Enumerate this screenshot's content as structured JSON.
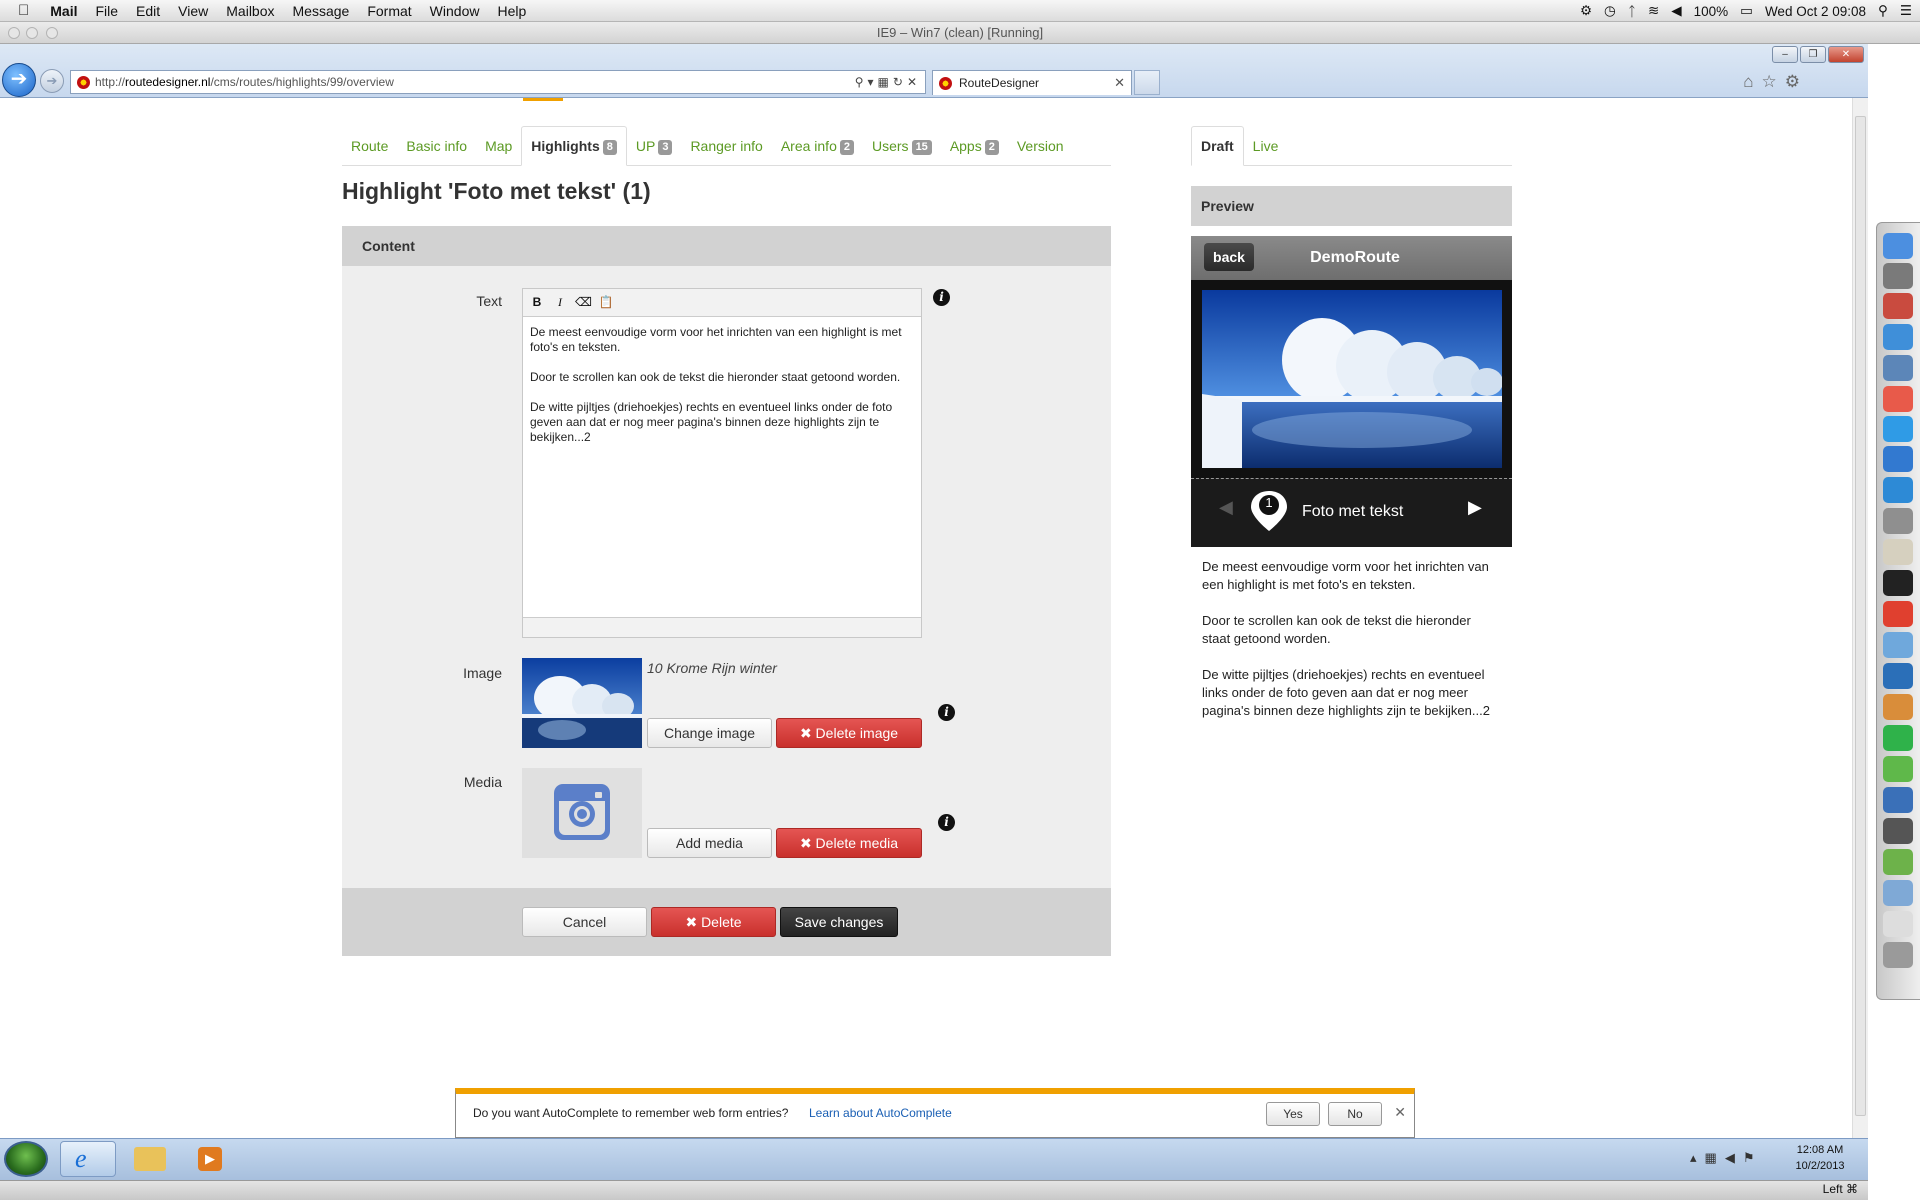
{
  "menubar": {
    "app": "Mail",
    "items": [
      "File",
      "Edit",
      "View",
      "Mailbox",
      "Message",
      "Format",
      "Window",
      "Help"
    ],
    "battery": "100%",
    "datetime": "Wed Oct 2  09:08"
  },
  "vm_title": "IE9 – Win7 (clean) [Running]",
  "browser": {
    "url_prefix": "http://",
    "url_domain": "routedesigner.nl",
    "url_path": "/cms/routes/highlights/99/overview",
    "tab_title": "RouteDesigner"
  },
  "tabs": [
    {
      "label": "Route",
      "badge": ""
    },
    {
      "label": "Basic info",
      "badge": ""
    },
    {
      "label": "Map",
      "badge": ""
    },
    {
      "label": "Highlights",
      "badge": "8",
      "active": true
    },
    {
      "label": "UP",
      "badge": "3"
    },
    {
      "label": "Ranger info",
      "badge": ""
    },
    {
      "label": "Area info",
      "badge": "2"
    },
    {
      "label": "Users",
      "badge": "15"
    },
    {
      "label": "Apps",
      "badge": "2"
    },
    {
      "label": "Version",
      "badge": ""
    }
  ],
  "page_title": "Highlight 'Foto met tekst' (1)",
  "content": {
    "section_title": "Content",
    "text_label": "Text",
    "editor_tools": [
      "B",
      "I",
      "eraser",
      "paste"
    ],
    "paragraphs": [
      "De meest eenvoudige vorm voor het inrichten van een highlight is met foto's en teksten.",
      "Door te scrollen kan ook de tekst die hieronder staat getoond worden.",
      "De witte pijltjes (driehoekjes) rechts en eventueel links onder de foto geven aan dat er nog meer pagina's binnen deze highlights zijn te bekijken...2"
    ],
    "image_label": "Image",
    "image_name": "10 Krome Rijn winter",
    "change_image": "Change image",
    "delete_image": "✖ Delete image",
    "media_label": "Media",
    "add_media": "Add media",
    "delete_media": "✖ Delete media",
    "cancel": "Cancel",
    "delete": "✖ Delete",
    "save": "Save changes"
  },
  "preview": {
    "tabs": [
      "Draft",
      "Live"
    ],
    "title": "Preview",
    "back": "back",
    "app_title": "DemoRoute",
    "marker_number": "1",
    "highlight_title": "Foto met tekst"
  },
  "notification": {
    "message": "Do you want AutoComplete to remember web form entries?",
    "link": "Learn about AutoComplete",
    "yes": "Yes",
    "no": "No"
  },
  "taskbar": {
    "time": "12:08 AM",
    "date": "10/2/2013"
  },
  "vm_status": "Left ⌘"
}
